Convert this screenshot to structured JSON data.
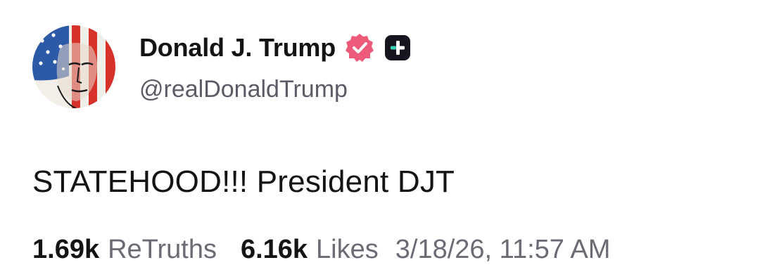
{
  "author": {
    "display_name": "Donald J. Trump",
    "handle": "@realDonaldTrump",
    "verified_icon": "verified-badge-icon",
    "verified_color": "#ee5a7a",
    "plus_icon": "truth-plus-icon"
  },
  "post": {
    "text": "STATEHOOD!!! President DJT"
  },
  "stats": {
    "retruths_count": "1.69k",
    "retruths_label": "ReTruths",
    "likes_count": "6.16k",
    "likes_label": "Likes",
    "timestamp": "3/18/26, 11:57 AM"
  }
}
